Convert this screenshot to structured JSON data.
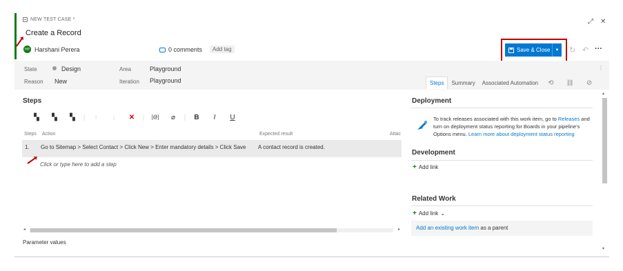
{
  "header": {
    "type_label": "NEW TEST CASE *",
    "title": "Create a Record",
    "owner_name": "Harshani Perera",
    "avatar_initials": "HP",
    "comments_label": "0 comments",
    "add_tag_label": "Add tag",
    "expand_glyph": "⤢",
    "close_glyph": "✕"
  },
  "toolbar": {
    "save_label": "Save & Close",
    "dropdown_glyph": "▼",
    "refresh_glyph": "↻",
    "undo_glyph": "↶",
    "more_glyph": "···"
  },
  "fields": {
    "state_label": "State",
    "state_value": "Design",
    "area_label": "Area",
    "area_value": "Playground",
    "reason_label": "Reason",
    "reason_value": "New",
    "iteration_label": "Iteration",
    "iteration_value": "Playground",
    "kebab_glyph": "⋮"
  },
  "tabs": {
    "steps": "Steps",
    "summary": "Summary",
    "associated": "Associated Automation",
    "history_glyph": "⟲",
    "links_glyph": "🔗",
    "attach_glyph": "📎"
  },
  "steps": {
    "title": "Steps",
    "toolbar_glyphs": {
      "insert_step": "▚",
      "insert_shared": "▚",
      "create_shared": "▚",
      "move_up": "↑",
      "move_down": "↓",
      "delete": "✕",
      "param": "[@]",
      "attach": "⌀",
      "bold": "B",
      "italic": "I",
      "underline": "U"
    },
    "col_steps": "Steps",
    "col_action": "Action",
    "col_expected": "Expected result",
    "col_attach": "Attac",
    "rows": [
      {
        "num": "1.",
        "action": "Go to Sitemap > Select Contact > Click New > Enter mandatory details > Click Save",
        "expected": "A contact record is created."
      }
    ],
    "add_step_placeholder": "Click or type here to add a step",
    "scroll_left": "◂",
    "scroll_right": "▸",
    "parameter_values": "Parameter values"
  },
  "deployment": {
    "title": "Deployment",
    "text_pre": "To track releases associated with this work item, go to ",
    "releases_link": "Releases",
    "text_mid": " and turn on deployment status reporting for Boards in your pipeline's Options menu. ",
    "learn_more_link": "Learn more about deployment status reporting"
  },
  "development": {
    "title": "Development",
    "add_link": "Add link"
  },
  "related_work": {
    "title": "Related Work",
    "add_link": "Add link",
    "add_link_chevron": "⌄",
    "existing_link": "Add an existing work item",
    "existing_suffix": " as a parent"
  },
  "scrollbar": {
    "up": "▴",
    "down": "▾"
  },
  "colors": {
    "accent": "#0078d4",
    "state_green": "#107c10",
    "highlight_red": "#c00000"
  }
}
